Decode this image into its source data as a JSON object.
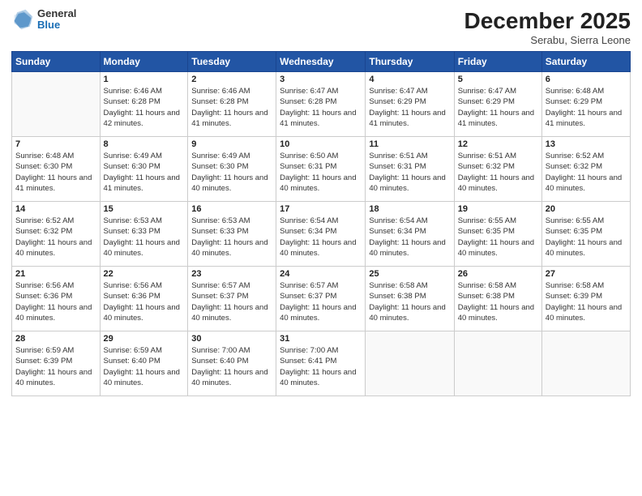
{
  "logo": {
    "general": "General",
    "blue": "Blue"
  },
  "header": {
    "month": "December 2025",
    "location": "Serabu, Sierra Leone"
  },
  "weekdays": [
    "Sunday",
    "Monday",
    "Tuesday",
    "Wednesday",
    "Thursday",
    "Friday",
    "Saturday"
  ],
  "weeks": [
    [
      {
        "day": "",
        "sunrise": "",
        "sunset": "",
        "daylight": ""
      },
      {
        "day": "1",
        "sunrise": "Sunrise: 6:46 AM",
        "sunset": "Sunset: 6:28 PM",
        "daylight": "Daylight: 11 hours and 42 minutes."
      },
      {
        "day": "2",
        "sunrise": "Sunrise: 6:46 AM",
        "sunset": "Sunset: 6:28 PM",
        "daylight": "Daylight: 11 hours and 41 minutes."
      },
      {
        "day": "3",
        "sunrise": "Sunrise: 6:47 AM",
        "sunset": "Sunset: 6:28 PM",
        "daylight": "Daylight: 11 hours and 41 minutes."
      },
      {
        "day": "4",
        "sunrise": "Sunrise: 6:47 AM",
        "sunset": "Sunset: 6:29 PM",
        "daylight": "Daylight: 11 hours and 41 minutes."
      },
      {
        "day": "5",
        "sunrise": "Sunrise: 6:47 AM",
        "sunset": "Sunset: 6:29 PM",
        "daylight": "Daylight: 11 hours and 41 minutes."
      },
      {
        "day": "6",
        "sunrise": "Sunrise: 6:48 AM",
        "sunset": "Sunset: 6:29 PM",
        "daylight": "Daylight: 11 hours and 41 minutes."
      }
    ],
    [
      {
        "day": "7",
        "sunrise": "Sunrise: 6:48 AM",
        "sunset": "Sunset: 6:30 PM",
        "daylight": "Daylight: 11 hours and 41 minutes."
      },
      {
        "day": "8",
        "sunrise": "Sunrise: 6:49 AM",
        "sunset": "Sunset: 6:30 PM",
        "daylight": "Daylight: 11 hours and 41 minutes."
      },
      {
        "day": "9",
        "sunrise": "Sunrise: 6:49 AM",
        "sunset": "Sunset: 6:30 PM",
        "daylight": "Daylight: 11 hours and 40 minutes."
      },
      {
        "day": "10",
        "sunrise": "Sunrise: 6:50 AM",
        "sunset": "Sunset: 6:31 PM",
        "daylight": "Daylight: 11 hours and 40 minutes."
      },
      {
        "day": "11",
        "sunrise": "Sunrise: 6:51 AM",
        "sunset": "Sunset: 6:31 PM",
        "daylight": "Daylight: 11 hours and 40 minutes."
      },
      {
        "day": "12",
        "sunrise": "Sunrise: 6:51 AM",
        "sunset": "Sunset: 6:32 PM",
        "daylight": "Daylight: 11 hours and 40 minutes."
      },
      {
        "day": "13",
        "sunrise": "Sunrise: 6:52 AM",
        "sunset": "Sunset: 6:32 PM",
        "daylight": "Daylight: 11 hours and 40 minutes."
      }
    ],
    [
      {
        "day": "14",
        "sunrise": "Sunrise: 6:52 AM",
        "sunset": "Sunset: 6:32 PM",
        "daylight": "Daylight: 11 hours and 40 minutes."
      },
      {
        "day": "15",
        "sunrise": "Sunrise: 6:53 AM",
        "sunset": "Sunset: 6:33 PM",
        "daylight": "Daylight: 11 hours and 40 minutes."
      },
      {
        "day": "16",
        "sunrise": "Sunrise: 6:53 AM",
        "sunset": "Sunset: 6:33 PM",
        "daylight": "Daylight: 11 hours and 40 minutes."
      },
      {
        "day": "17",
        "sunrise": "Sunrise: 6:54 AM",
        "sunset": "Sunset: 6:34 PM",
        "daylight": "Daylight: 11 hours and 40 minutes."
      },
      {
        "day": "18",
        "sunrise": "Sunrise: 6:54 AM",
        "sunset": "Sunset: 6:34 PM",
        "daylight": "Daylight: 11 hours and 40 minutes."
      },
      {
        "day": "19",
        "sunrise": "Sunrise: 6:55 AM",
        "sunset": "Sunset: 6:35 PM",
        "daylight": "Daylight: 11 hours and 40 minutes."
      },
      {
        "day": "20",
        "sunrise": "Sunrise: 6:55 AM",
        "sunset": "Sunset: 6:35 PM",
        "daylight": "Daylight: 11 hours and 40 minutes."
      }
    ],
    [
      {
        "day": "21",
        "sunrise": "Sunrise: 6:56 AM",
        "sunset": "Sunset: 6:36 PM",
        "daylight": "Daylight: 11 hours and 40 minutes."
      },
      {
        "day": "22",
        "sunrise": "Sunrise: 6:56 AM",
        "sunset": "Sunset: 6:36 PM",
        "daylight": "Daylight: 11 hours and 40 minutes."
      },
      {
        "day": "23",
        "sunrise": "Sunrise: 6:57 AM",
        "sunset": "Sunset: 6:37 PM",
        "daylight": "Daylight: 11 hours and 40 minutes."
      },
      {
        "day": "24",
        "sunrise": "Sunrise: 6:57 AM",
        "sunset": "Sunset: 6:37 PM",
        "daylight": "Daylight: 11 hours and 40 minutes."
      },
      {
        "day": "25",
        "sunrise": "Sunrise: 6:58 AM",
        "sunset": "Sunset: 6:38 PM",
        "daylight": "Daylight: 11 hours and 40 minutes."
      },
      {
        "day": "26",
        "sunrise": "Sunrise: 6:58 AM",
        "sunset": "Sunset: 6:38 PM",
        "daylight": "Daylight: 11 hours and 40 minutes."
      },
      {
        "day": "27",
        "sunrise": "Sunrise: 6:58 AM",
        "sunset": "Sunset: 6:39 PM",
        "daylight": "Daylight: 11 hours and 40 minutes."
      }
    ],
    [
      {
        "day": "28",
        "sunrise": "Sunrise: 6:59 AM",
        "sunset": "Sunset: 6:39 PM",
        "daylight": "Daylight: 11 hours and 40 minutes."
      },
      {
        "day": "29",
        "sunrise": "Sunrise: 6:59 AM",
        "sunset": "Sunset: 6:40 PM",
        "daylight": "Daylight: 11 hours and 40 minutes."
      },
      {
        "day": "30",
        "sunrise": "Sunrise: 7:00 AM",
        "sunset": "Sunset: 6:40 PM",
        "daylight": "Daylight: 11 hours and 40 minutes."
      },
      {
        "day": "31",
        "sunrise": "Sunrise: 7:00 AM",
        "sunset": "Sunset: 6:41 PM",
        "daylight": "Daylight: 11 hours and 40 minutes."
      },
      {
        "day": "",
        "sunrise": "",
        "sunset": "",
        "daylight": ""
      },
      {
        "day": "",
        "sunrise": "",
        "sunset": "",
        "daylight": ""
      },
      {
        "day": "",
        "sunrise": "",
        "sunset": "",
        "daylight": ""
      }
    ]
  ]
}
